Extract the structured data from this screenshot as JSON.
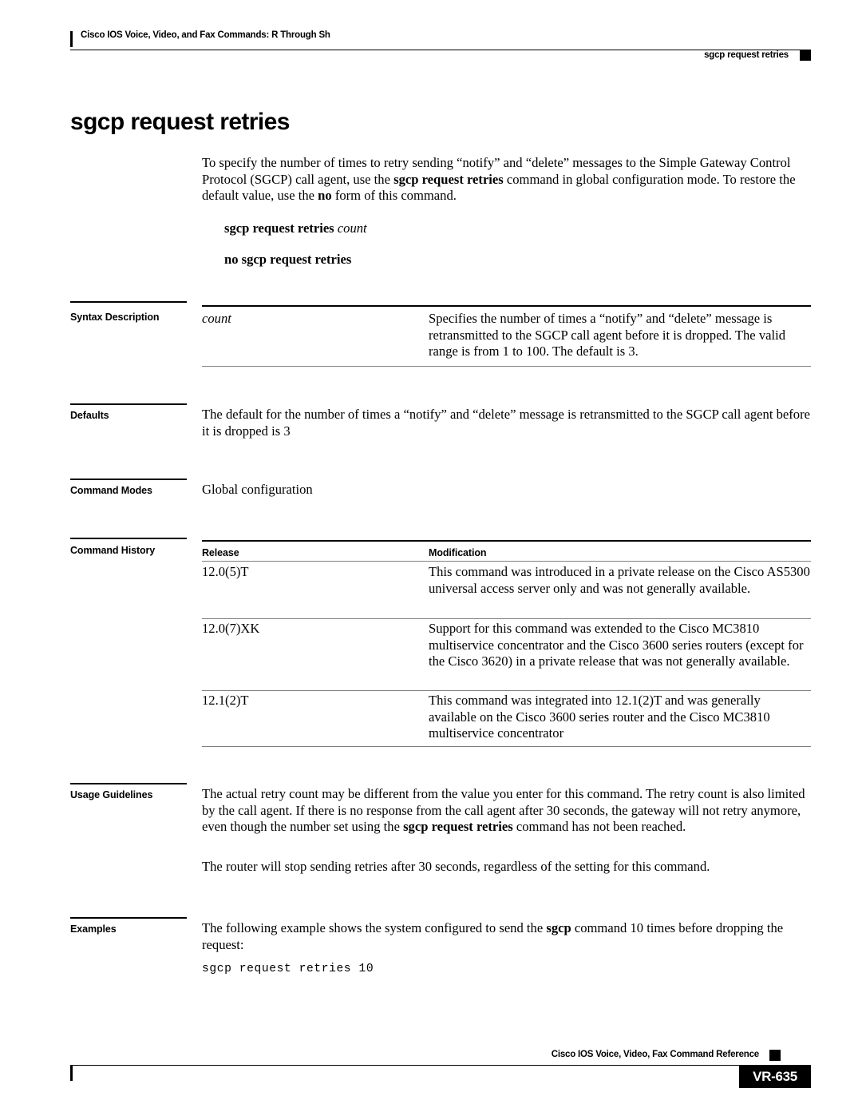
{
  "header": {
    "left_text": "Cisco IOS Voice, Video, and Fax Commands: R Through Sh",
    "right_text": "sgcp request retries"
  },
  "command": {
    "title": "sgcp request retries",
    "description_html": "To specify the number of times to retry sending “notify” and “delete” messages to the Simple Gateway Control Protocol (SGCP) call agent, use the <b>sgcp request retries</b> command in global configuration mode. To restore the default value, use the <b>no</b> form of this command.",
    "syntax_html": "sgcp request retries <i>count</i>",
    "no_syntax_html": "no sgcp request retries"
  },
  "sections": {
    "syntax_description": {
      "label": "Syntax Description",
      "rows": [
        {
          "term_html": "<i>count</i>",
          "definition": "Specifies the number of times a “notify” and “delete” message is retransmitted to the SGCP call agent before it is dropped. The valid range is from 1 to 100. The default is 3."
        }
      ]
    },
    "defaults": {
      "label": "Defaults",
      "text": "The default for the number of times a “notify” and “delete” message is retransmitted to the SGCP call agent before it is dropped is 3"
    },
    "command_modes": {
      "label": "Command Modes",
      "text": "Global configuration"
    },
    "command_history": {
      "label": "Command History",
      "columns": [
        "Release",
        "Modification"
      ],
      "rows": [
        {
          "release": "12.0(5)T",
          "modification": "This command was introduced in a private release on the Cisco AS5300 universal access server only and was not generally available."
        },
        {
          "release": "12.0(7)XK",
          "modification": "Support for this command was extended to the Cisco MC3810 multiservice concentrator and the Cisco 3600 series routers (except for the Cisco 3620) in a private release that was not generally available."
        },
        {
          "release": "12.1(2)T",
          "modification": "This command was integrated into 12.1(2)T and was generally available on the Cisco 3600 series router and the Cisco MC3810 multiservice concentrator"
        }
      ]
    },
    "usage_guidelines": {
      "label": "Usage Guidelines",
      "paragraph1_html": "The actual retry count may be different from the value you enter for this command. The retry count is also limited by the call agent. If there is no response from the call agent after 30 seconds, the gateway will not retry anymore, even though the number set using the <b>sgcp request retries</b> command has not been reached.",
      "paragraph2": "The router will stop sending retries after 30 seconds, regardless of the setting for this command."
    },
    "examples": {
      "label": "Examples",
      "intro_html": "The following example shows the system configured to send the <b>sgcp</b> command 10 times before dropping the request:",
      "code": "sgcp request retries 10"
    }
  },
  "footer": {
    "text": "Cisco IOS Voice, Video, Fax Command Reference",
    "page_number": "VR-635"
  }
}
